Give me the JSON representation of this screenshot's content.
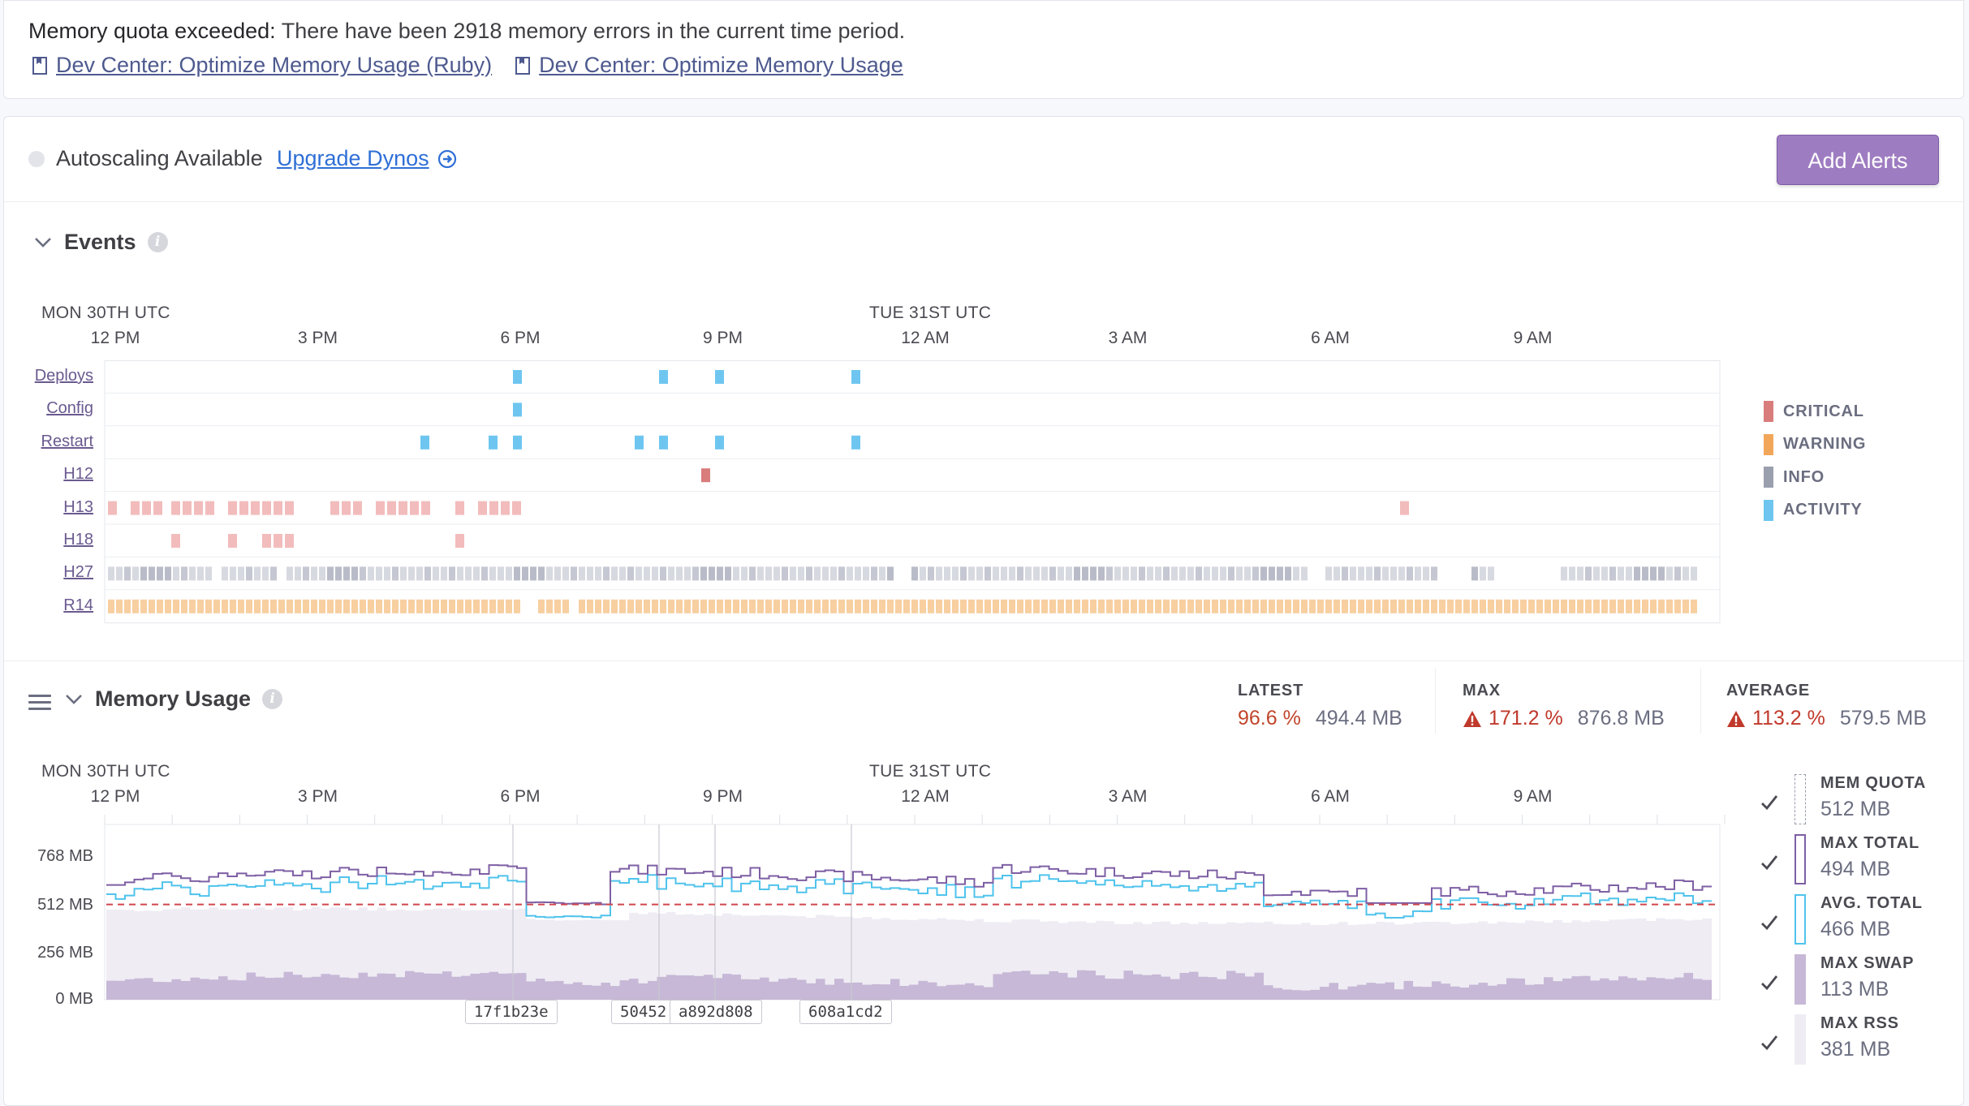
{
  "alert": {
    "title": "Memory quota exceeded:",
    "message": "There have been 2918 memory errors in the current time period.",
    "links": [
      "Dev Center: Optimize Memory Usage (Ruby)",
      "Dev Center: Optimize Memory Usage"
    ]
  },
  "topbar": {
    "autoscaling_text": "Autoscaling Available",
    "upgrade_link": "Upgrade Dynos",
    "add_alerts_label": "Add Alerts"
  },
  "events": {
    "title": "Events",
    "tz_left": "MON 30TH UTC",
    "tz_right": "TUE 31ST UTC",
    "time_labels": [
      "12 PM",
      "3 PM",
      "6 PM",
      "9 PM",
      "12 AM",
      "3 AM",
      "6 AM",
      "9 AM"
    ],
    "rows": [
      "Deploys",
      "Config",
      "Restart",
      "H12",
      "H13",
      "H18",
      "H27",
      "R14"
    ],
    "legend": [
      {
        "label": "CRITICAL",
        "color": "#d97c7c"
      },
      {
        "label": "WARNING",
        "color": "#f2a65a"
      },
      {
        "label": "INFO",
        "color": "#9a9fae"
      },
      {
        "label": "ACTIVITY",
        "color": "#6ec6f0"
      }
    ]
  },
  "memory": {
    "title": "Memory Usage",
    "stats": {
      "latest": {
        "title": "LATEST",
        "pct": "96.6 %",
        "mb": "494.4 MB"
      },
      "max": {
        "title": "MAX",
        "pct": "171.2 %",
        "mb": "876.8 MB"
      },
      "average": {
        "title": "AVERAGE",
        "pct": "113.2 %",
        "mb": "579.5 MB"
      }
    },
    "tz_left": "MON 30TH UTC",
    "tz_right": "TUE 31ST UTC",
    "time_labels": [
      "12 PM",
      "3 PM",
      "6 PM",
      "9 PM",
      "12 AM",
      "3 AM",
      "6 AM",
      "9 AM"
    ],
    "y_labels": [
      "768 MB",
      "512 MB",
      "256 MB",
      "0 MB"
    ],
    "commits": [
      "17f1b23e",
      "50452",
      "a892d808",
      "608a1cd2"
    ],
    "legend": [
      {
        "title": "MEM QUOTA",
        "value": "512 MB"
      },
      {
        "title": "MAX TOTAL",
        "value": "494 MB"
      },
      {
        "title": "AVG. TOTAL",
        "value": "466 MB"
      },
      {
        "title": "MAX SWAP",
        "value": "113 MB"
      },
      {
        "title": "MAX RSS",
        "value": "381 MB"
      }
    ],
    "colors": {
      "quota": "#d0454c",
      "max_total": "#7e5fa4",
      "avg_total": "#4fc3ec",
      "swap": "#c6b8d6",
      "rss": "#efecf4"
    }
  }
}
